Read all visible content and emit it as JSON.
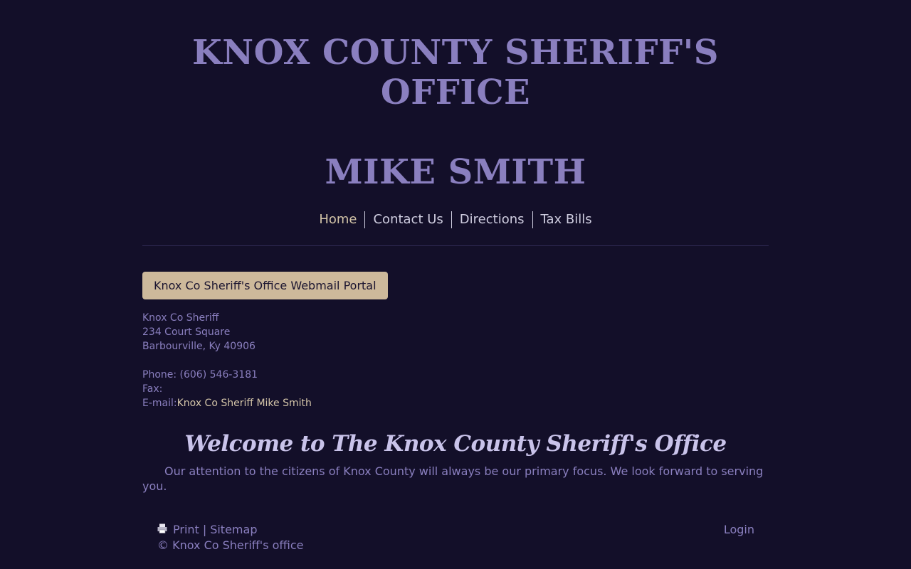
{
  "header": {
    "title": "KNOX COUNTY SHERIFF'S OFFICE",
    "sheriff_name": "MIKE SMITH"
  },
  "nav": {
    "items": [
      {
        "label": "Home",
        "active": true
      },
      {
        "label": "Contact Us",
        "active": false
      },
      {
        "label": "Directions",
        "active": false
      },
      {
        "label": "Tax Bills",
        "active": false
      }
    ]
  },
  "webmail": {
    "button_label": "Knox Co Sheriff's Office Webmail Portal"
  },
  "contact": {
    "name": "Knox Co Sheriff",
    "street": "234 Court Square",
    "city": "Barbourville, Ky 40906",
    "phone": "Phone: (606) 546-3181",
    "fax": "Fax:",
    "email_label": "E-mail:",
    "email_link": "Knox Co Sheriff Mike Smith"
  },
  "welcome": {
    "heading": "Welcome to The Knox County Sheriff's Office",
    "text": "Our attention to the citizens of Knox County will always be our primary focus.  We look forward to serving you."
  },
  "footer": {
    "print_label": "Print",
    "separator": "|",
    "sitemap_label": "Sitemap",
    "copyright": "© Knox Co Sheriff's office",
    "login_label": "Login"
  },
  "colors": {
    "background": "#130f29",
    "title": "#8a7fbf",
    "accent": "#d3c4a8",
    "button": "#cdb99b"
  },
  "icons": {
    "print": "printer-icon"
  }
}
